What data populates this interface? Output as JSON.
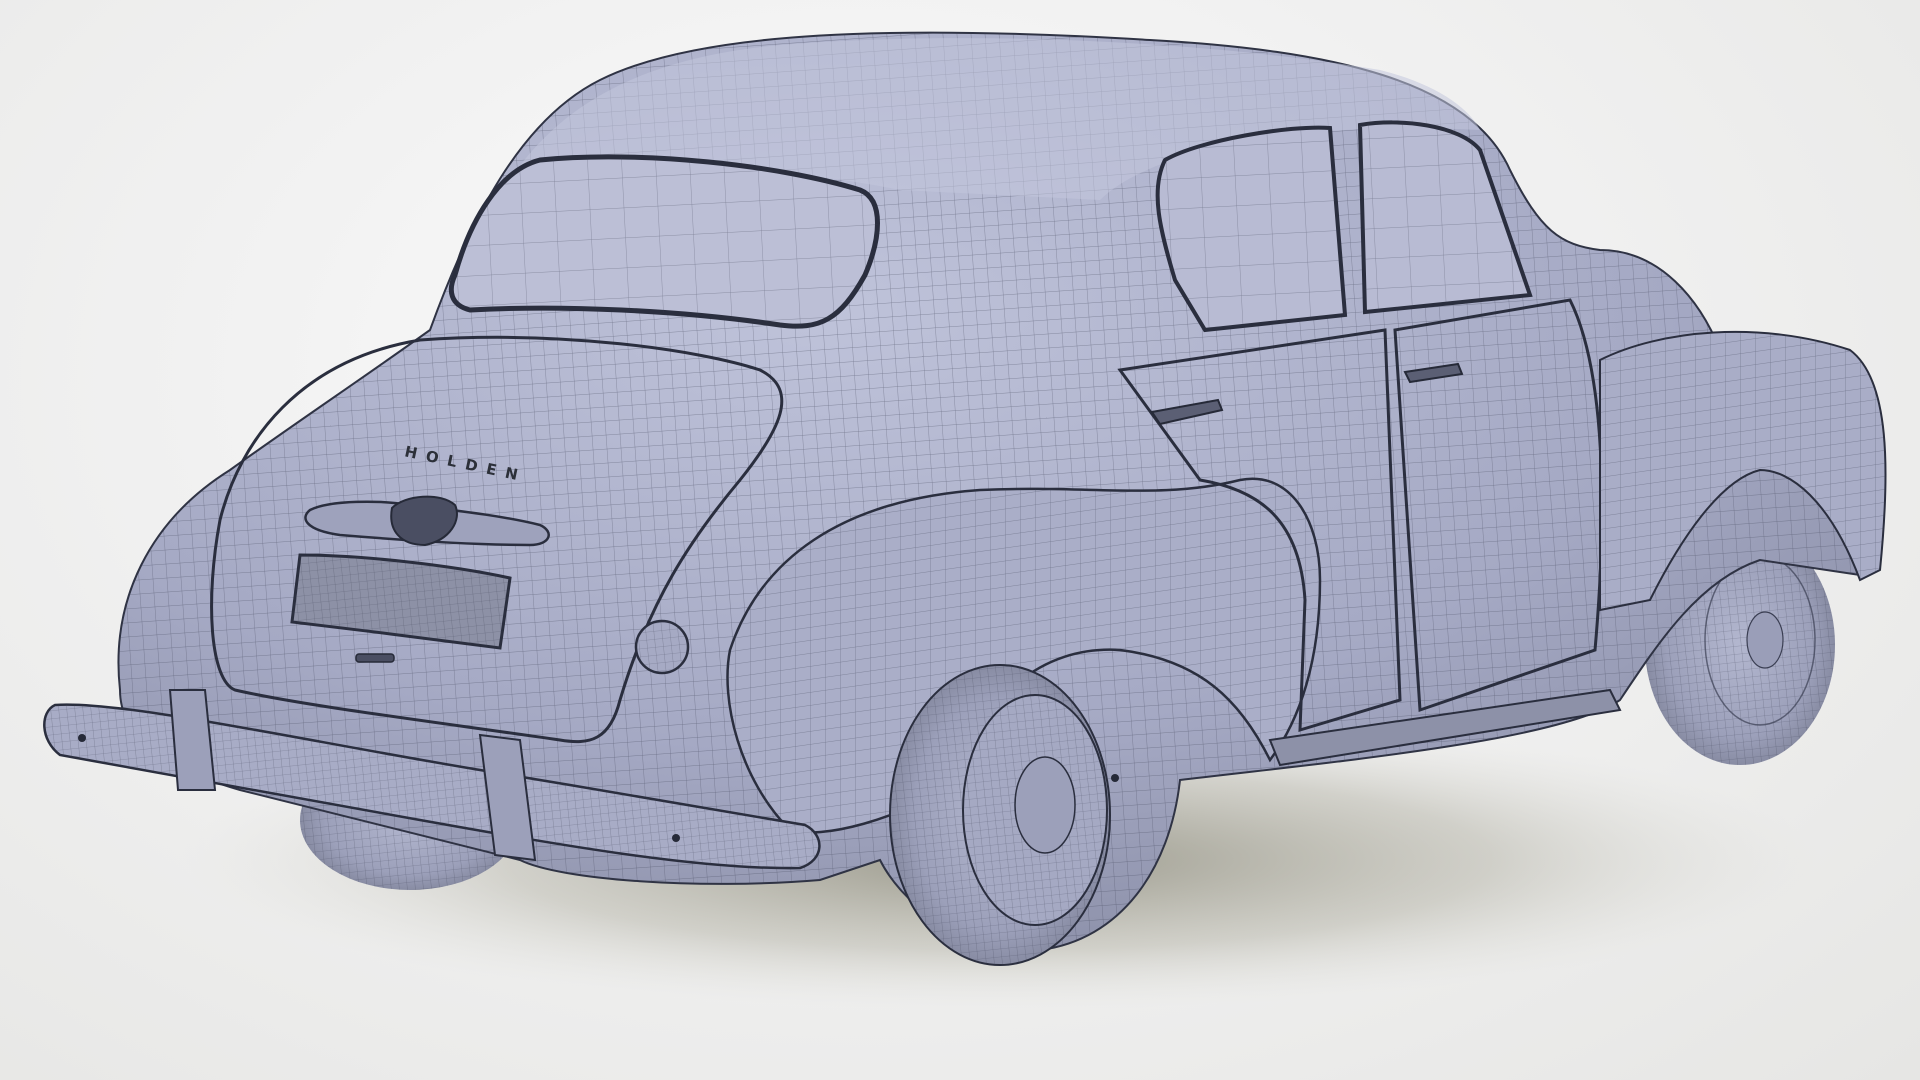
{
  "image": {
    "subject": "car-wireframe-render"
  },
  "emblem": {
    "text": "HOLDEN"
  },
  "colors": {
    "background": "#f2f2f2",
    "body": "#a4a8c4",
    "body_light": "#bcc0d8",
    "body_shadow": "#7e8298",
    "wire": "#3a3e52",
    "glass": "#b6b9d2",
    "tire": "#9a9eb8",
    "ground_shadow": "#8c8a78"
  }
}
